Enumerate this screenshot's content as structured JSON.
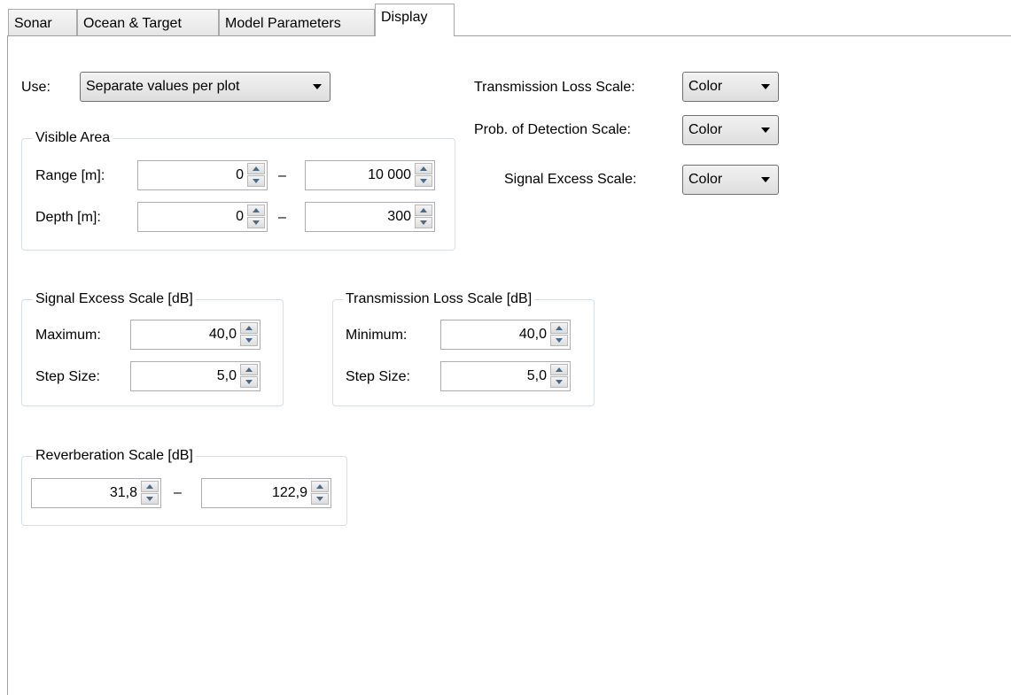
{
  "tabs": [
    {
      "label": "Sonar"
    },
    {
      "label": "Ocean & Target"
    },
    {
      "label": "Model Parameters"
    },
    {
      "label": "Display",
      "active": true
    }
  ],
  "use": {
    "label": "Use:",
    "value": "Separate values per plot"
  },
  "visible_area": {
    "title": "Visible Area",
    "range": {
      "label": "Range [m]:",
      "min": "0",
      "max": "10 000"
    },
    "depth": {
      "label": "Depth [m]:",
      "min": "0",
      "max": "300"
    },
    "separator": "–"
  },
  "scales": {
    "transmission_loss": {
      "label": "Transmission Loss Scale:",
      "value": "Color"
    },
    "prob_detection": {
      "label": "Prob. of Detection Scale:",
      "value": "Color"
    },
    "signal_excess": {
      "label": "Signal Excess Scale:",
      "value": "Color"
    }
  },
  "signal_excess_group": {
    "title": "Signal Excess Scale [dB]",
    "maximum": {
      "label": "Maximum:",
      "value": "40,0"
    },
    "step": {
      "label": "Step Size:",
      "value": "5,0"
    }
  },
  "transmission_loss_group": {
    "title": "Transmission Loss Scale [dB]",
    "minimum": {
      "label": "Minimum:",
      "value": "40,0"
    },
    "step": {
      "label": "Step Size:",
      "value": "5,0"
    }
  },
  "reverberation_group": {
    "title": "Reverberation Scale [dB]",
    "min": "31,8",
    "max": "122,9",
    "separator": "–"
  }
}
